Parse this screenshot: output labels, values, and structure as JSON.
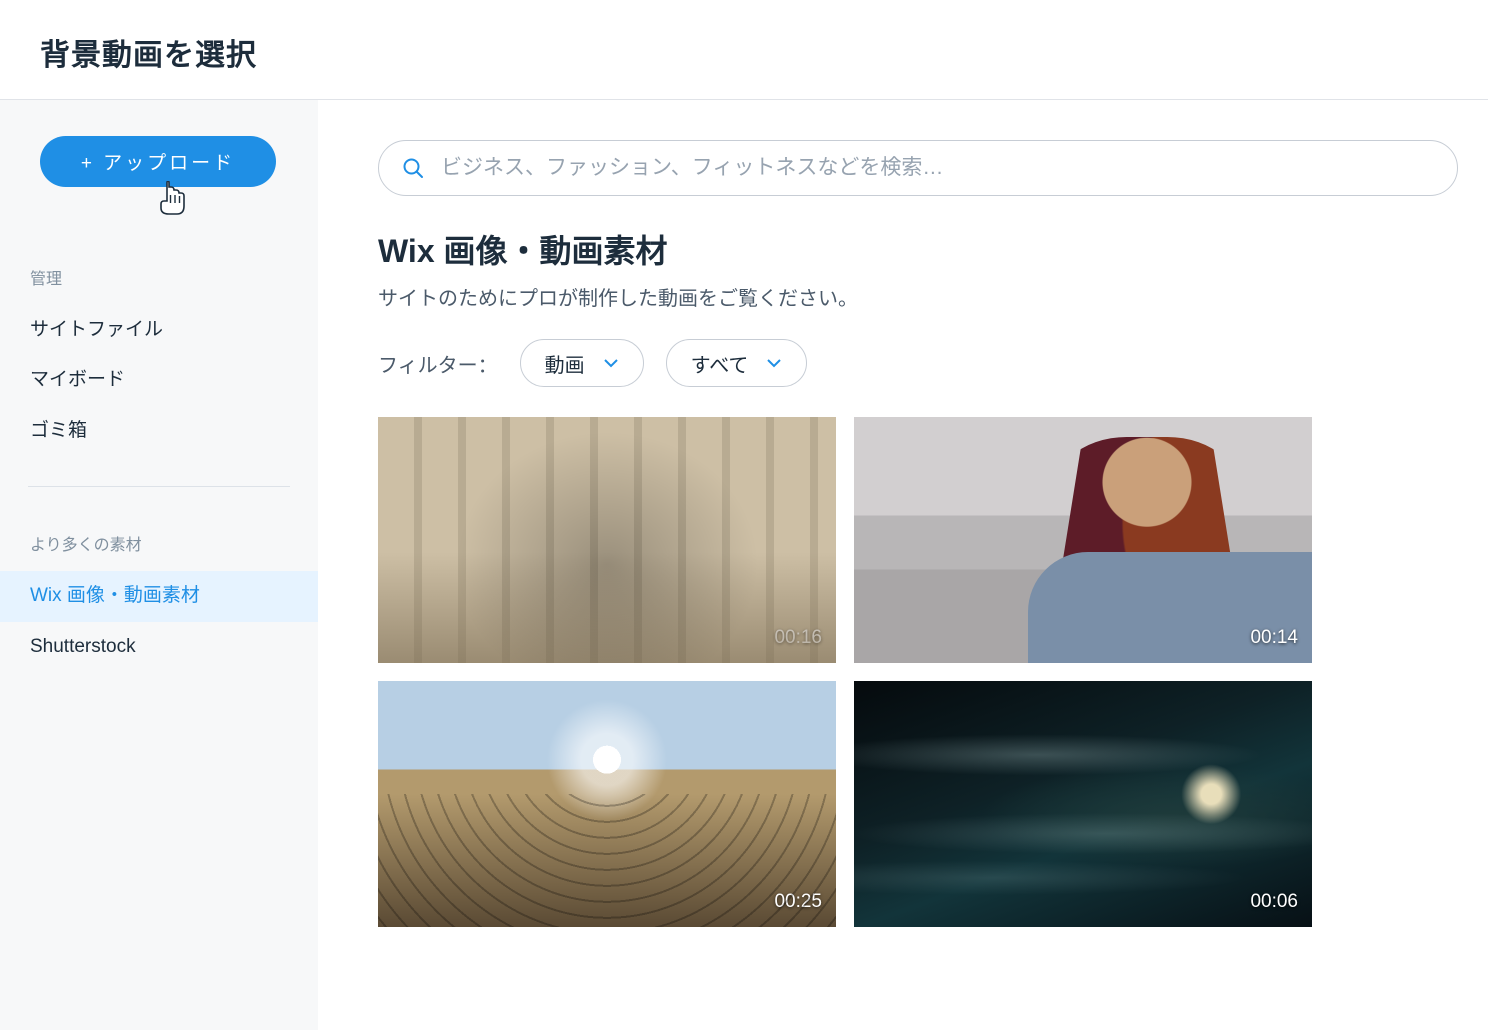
{
  "header": {
    "title": "背景動画を選択"
  },
  "sidebar": {
    "upload_label": "+ アップロード",
    "sections": {
      "manage": {
        "label": "管理",
        "items": [
          "サイトファイル",
          "マイボード",
          "ゴミ箱"
        ]
      },
      "more": {
        "label": "より多くの素材",
        "items": [
          "Wix 画像・動画素材",
          "Shutterstock"
        ],
        "active_index": 0
      }
    }
  },
  "search": {
    "placeholder": "ビジネス、ファッション、フィットネスなどを検索…"
  },
  "main": {
    "title": "Wix 画像・動画素材",
    "subtitle": "サイトのためにプロが制作した動画をご覧ください。"
  },
  "filters": {
    "label": "フィルター：",
    "type": {
      "selected": "動画"
    },
    "scope": {
      "selected": "すべて"
    }
  },
  "videos": [
    {
      "duration": "00:16"
    },
    {
      "duration": "00:14"
    },
    {
      "duration": "00:25"
    },
    {
      "duration": "00:06"
    }
  ]
}
